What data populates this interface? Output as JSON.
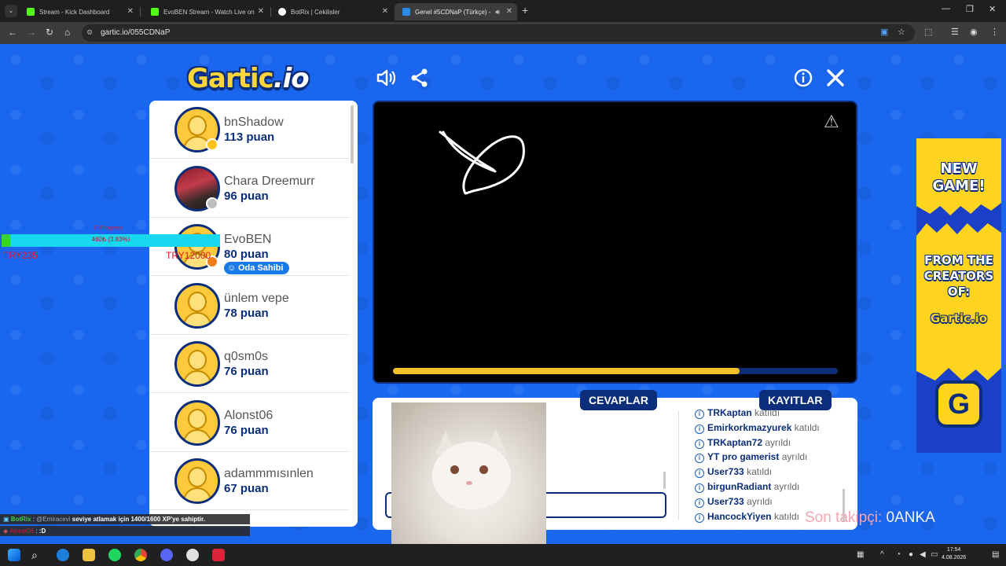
{
  "browser": {
    "tabs": [
      {
        "title": "Stream - Kick Dashboard",
        "color": "#53fc18"
      },
      {
        "title": "EvoBEN Stream - Watch Live on",
        "color": "#53fc18"
      },
      {
        "title": "BotRix | Cekilisler",
        "color": "#ffffff"
      },
      {
        "title": "Genel #5CDNaP (Türkçe) -",
        "color": "#2b8ae6"
      }
    ],
    "url": "gartic.io/055CDNaP"
  },
  "game": {
    "logo_main": "Gartic",
    "logo_io": ".io",
    "players": [
      {
        "name": "bnShadow",
        "score": "113 puan",
        "badge": "#ffc21a",
        "photo": false
      },
      {
        "name": "Chara Dreemurr",
        "score": "96 puan",
        "badge": "#bdbdbd",
        "photo": true
      },
      {
        "name": "EvoBEN",
        "score": "80 puan",
        "badge": "#f07d18",
        "photo": false,
        "owner": "Oda Sahibi"
      },
      {
        "name": "ünlem vepe",
        "score": "78 puan",
        "photo": false
      },
      {
        "name": "q0sm0s",
        "score": "76 puan",
        "photo": false
      },
      {
        "name": "Alonst06",
        "score": "76 puan",
        "photo": false
      },
      {
        "name": "adammmısınlen",
        "score": "67 puan",
        "photo": false
      }
    ],
    "timer_progress": 0.78,
    "tab_answers": "CEVAPLAR",
    "tab_logs": "KAYITLAR",
    "answer_placeholder": "",
    "logs": [
      {
        "name": "TRKaptan",
        "action": "katıldı"
      },
      {
        "name": "Emirkorkmazyurek",
        "action": "katıldı"
      },
      {
        "name": "TRKaptan72",
        "action": "ayrıldı"
      },
      {
        "name": "YT pro gamerist",
        "action": "ayrıldı"
      },
      {
        "name": "User733",
        "action": "katıldı"
      },
      {
        "name": "birgunRadiant",
        "action": "ayrıldı"
      },
      {
        "name": "User733",
        "action": "ayrıldı"
      },
      {
        "name": "HancockYiyen",
        "action": "katıldı"
      }
    ]
  },
  "ad": {
    "line1": "NEW",
    "line2": "GAME!",
    "line3": "FROM THE",
    "line4": "CREATORS",
    "line5": "OF:",
    "logo": "Gartic.io",
    "icon_letter": "G"
  },
  "overlay": {
    "goal_label": "BitProgress",
    "goal_value": "460₺ (3.83%)",
    "goal_fraction": 0.0383,
    "goal_start": "TRY235",
    "goal_end": "TRY12000",
    "chat": [
      {
        "user": "BotRix",
        "mention": "@Emiracevi",
        "message": "seviye atlamak için 1400/1600 XP'ye sahiptir."
      },
      {
        "user": "Alonst06",
        "message": ":D"
      }
    ],
    "follower_label": "Son takipçi:",
    "follower_name": "0ANKA"
  },
  "taskbar": {
    "time": "17:54",
    "date": "4.08.2026"
  }
}
